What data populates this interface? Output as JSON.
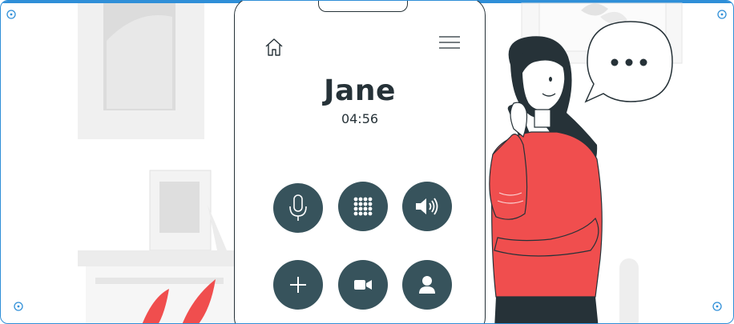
{
  "call": {
    "contact_name": "Jane",
    "duration": "04:56"
  },
  "icons": {
    "home": "home-icon",
    "menu": "hamburger-menu-icon",
    "mute": "microphone-icon",
    "keypad": "keypad-grid-icon",
    "speaker": "speaker-icon",
    "add_call": "plus-icon",
    "video": "video-camera-icon",
    "contacts": "person-icon",
    "typing": "ellipsis-icon"
  },
  "colors": {
    "button_fill": "#37535c",
    "text": "#263238",
    "accent": "#f04e4e",
    "border": "#2f8fd8"
  }
}
